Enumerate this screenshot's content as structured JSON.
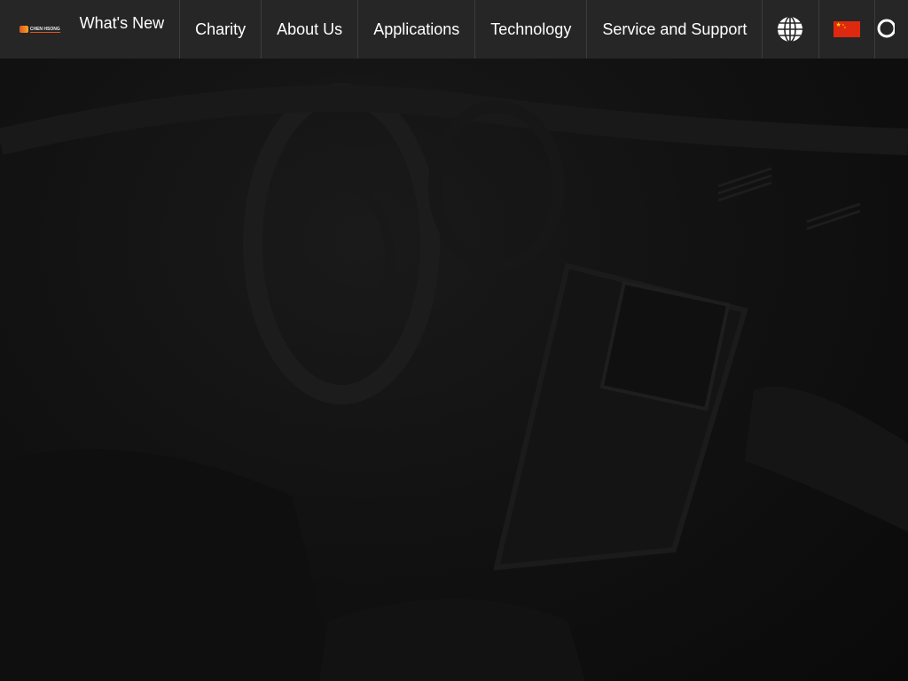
{
  "brand": {
    "logo_text": "CHEN HSONG"
  },
  "nav": {
    "items": [
      {
        "label": "What's New"
      },
      {
        "label": "Charity"
      },
      {
        "label": "About Us"
      },
      {
        "label": "Applications"
      },
      {
        "label": "Technology"
      },
      {
        "label": "Service and Support"
      }
    ],
    "icons": {
      "language": "globe-icon",
      "region_flag": "china-flag-icon",
      "search": "search-icon"
    }
  },
  "colors": {
    "navbar_bg": "#262626",
    "hero_bg": "#0b0b0b",
    "accent": "#e0561c",
    "flag_red": "#de2910",
    "flag_star": "#ffde00"
  }
}
